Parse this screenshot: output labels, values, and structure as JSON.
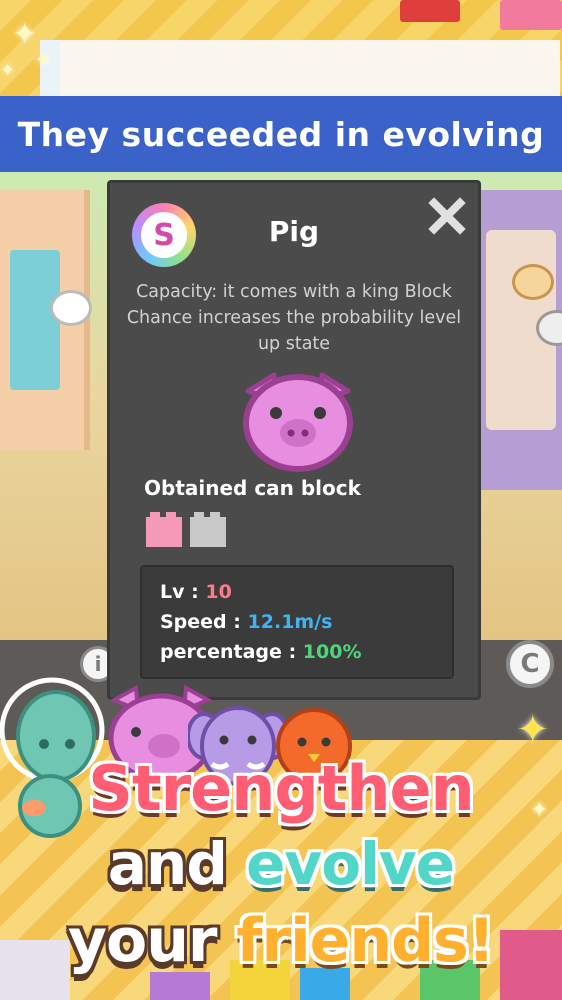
{
  "banner": {
    "text": "They succeeded in evolving"
  },
  "modal": {
    "rank_letter": "S",
    "title": "Pig",
    "description": "Capacity: it comes with a king Block Chance increases the probability level up state",
    "character_icon": "pig-face-icon",
    "obtained_label": "Obtained can block",
    "blocks": [
      {
        "color": "#f49ab8"
      },
      {
        "color": "#c9c9c9"
      }
    ],
    "stats": {
      "lv_label": "Lv",
      "lv_value": "10",
      "speed_label": "Speed",
      "speed_value": "12.1m/s",
      "percentage_label": "percentage",
      "percentage_value": "100%",
      "separator": ":"
    },
    "colors": {
      "lv_value": "#ff7a8a",
      "speed_value": "#3fb4f0",
      "percentage_value": "#4fd67a"
    }
  },
  "side_buttons": {
    "info_label": "i",
    "c_label": "C"
  },
  "headline": {
    "line1": "Strengthen",
    "line2_a": "and",
    "line2_b": "evolve",
    "line3_a": "your",
    "line3_b": "friends!"
  }
}
